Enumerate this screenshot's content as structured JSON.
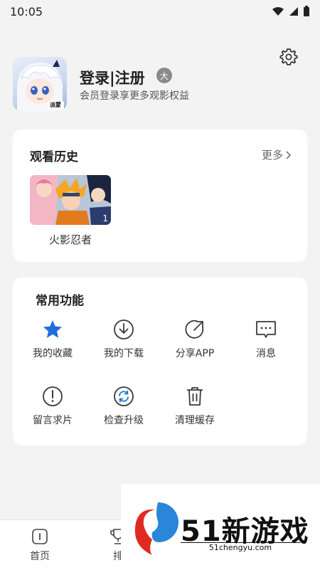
{
  "status_bar": {
    "time": "10:05"
  },
  "profile": {
    "title": "登录|注册",
    "badge": "大",
    "subtitle": "会员登录享更多观影权益",
    "avatar_text": "派蒙"
  },
  "history": {
    "title": "观看历史",
    "more": "更多",
    "items": [
      {
        "title": "火影忍者",
        "count": "1"
      }
    ]
  },
  "features": {
    "title": "常用功能",
    "items": [
      {
        "label": "我的收藏",
        "icon": "star-icon"
      },
      {
        "label": "我的下载",
        "icon": "download-icon"
      },
      {
        "label": "分享APP",
        "icon": "share-icon"
      },
      {
        "label": "消息",
        "icon": "message-icon"
      },
      {
        "label": "留言求片",
        "icon": "exclamation-icon"
      },
      {
        "label": "检查升级",
        "icon": "refresh-icon"
      },
      {
        "label": "清理缓存",
        "icon": "trash-icon"
      }
    ]
  },
  "tabbar": {
    "items": [
      {
        "label": "首页",
        "icon": "home-icon"
      },
      {
        "label": "排",
        "icon": "trophy-icon"
      }
    ]
  },
  "watermark": {
    "text": "51新游戏",
    "url": "51chengyu.com"
  },
  "colors": {
    "accent_blue": "#1e6fdc",
    "icon_dark": "#3a3a3a"
  }
}
